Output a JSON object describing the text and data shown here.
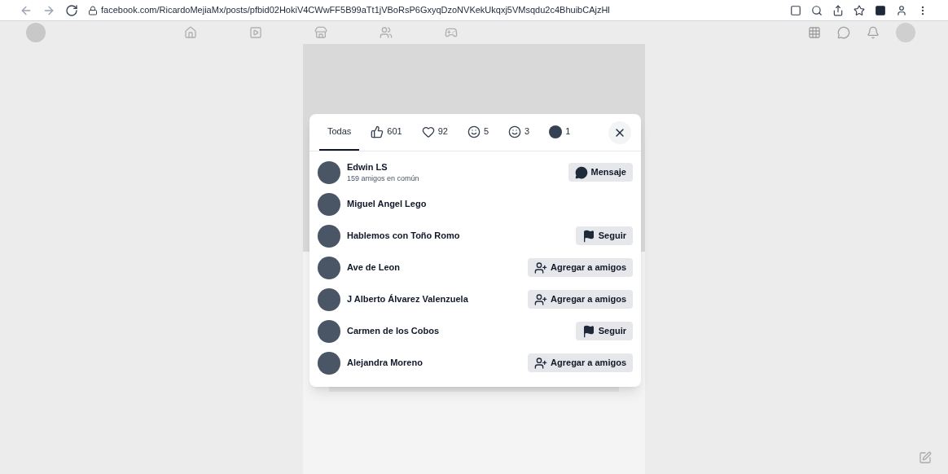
{
  "browser": {
    "url": "facebook.com/RicardoMejiaMx/posts/pfbid02HokiV4CWwFF5B99aTt1jVBoRsP6GxyqDzoNVKekUkqxj5VMsqdu2c4BhuibCAjzHl"
  },
  "reactions_dialog": {
    "tabs": [
      {
        "kind": "all",
        "label": "Todas",
        "selected": true
      },
      {
        "kind": "like",
        "label": "601",
        "selected": false
      },
      {
        "kind": "love",
        "label": "92",
        "selected": false
      },
      {
        "kind": "haha",
        "label": "5",
        "selected": false
      },
      {
        "kind": "care",
        "label": "3",
        "selected": false
      },
      {
        "kind": "angry",
        "label": "1",
        "selected": false
      }
    ],
    "people": [
      {
        "name": "Edwin LS",
        "subtitle": "159 amigos en común",
        "action": {
          "kind": "message",
          "label": "Mensaje"
        }
      },
      {
        "name": "Miguel Angel Lego"
      },
      {
        "name": "Hablemos con Toño Romo",
        "action": {
          "kind": "follow",
          "label": "Seguir"
        }
      },
      {
        "name": "Ave de Leon",
        "action": {
          "kind": "add_friend",
          "label": "Agregar a amigos"
        }
      },
      {
        "name": "J Alberto Álvarez Valenzuela",
        "action": {
          "kind": "add_friend",
          "label": "Agregar a amigos"
        }
      },
      {
        "name": "Carmen de los Cobos",
        "action": {
          "kind": "follow",
          "label": "Seguir"
        }
      },
      {
        "name": "Alejandra Moreno",
        "action": {
          "kind": "add_friend",
          "label": "Agregar a amigos"
        }
      }
    ]
  }
}
